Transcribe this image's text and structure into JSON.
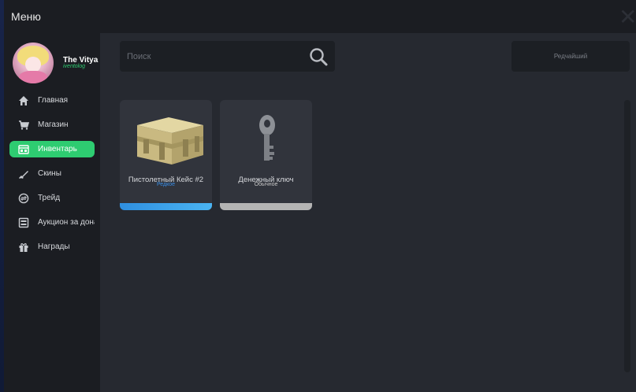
{
  "window": {
    "title": "Меню",
    "close_glyph": "✕"
  },
  "user": {
    "name": "The Vitya",
    "link": "iventolog"
  },
  "sidebar": {
    "items": [
      {
        "label": "Главная",
        "icon": "home-icon"
      },
      {
        "label": "Магазин",
        "icon": "cart-icon"
      },
      {
        "label": "Инвентарь",
        "icon": "inventory-icon",
        "active": true
      },
      {
        "label": "Скины",
        "icon": "rifle-icon"
      },
      {
        "label": "Трейд",
        "icon": "trade-icon"
      },
      {
        "label": "Аукцион за донат",
        "icon": "auction-icon"
      },
      {
        "label": "Награды",
        "icon": "gift-icon"
      }
    ]
  },
  "search": {
    "placeholder": "Поиск"
  },
  "sort": {
    "label": "Редчайший"
  },
  "items": [
    {
      "name": "Пистолетный Кейс #2",
      "rarity": "Редкое",
      "rarity_color": "#3a8ee6",
      "bar_color": "#3aa8ee",
      "icon": "case-icon"
    },
    {
      "name": "Денежный ключ",
      "rarity": "Обычное",
      "rarity_color": "#c8c8c8",
      "bar_color": "#b4b4b4",
      "icon": "key-icon"
    }
  ],
  "colors": {
    "accent": "#2ecc71",
    "panel": "#262930",
    "card": "#31343c"
  }
}
